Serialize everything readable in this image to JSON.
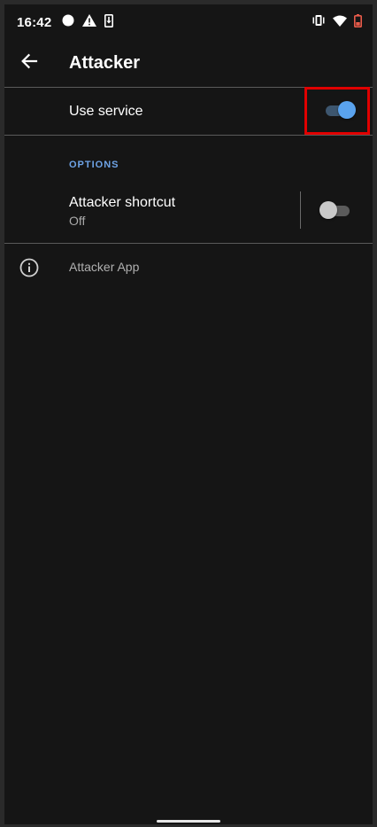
{
  "status_bar": {
    "time": "16:42",
    "icons_left": [
      "circle-notification-icon",
      "warning-icon",
      "download-icon"
    ],
    "icons_right": [
      "vibrate-icon",
      "wifi-icon",
      "battery-low-icon"
    ]
  },
  "app_bar": {
    "title": "Attacker",
    "back_icon": "arrow-left-icon"
  },
  "use_service": {
    "label": "Use service",
    "enabled": true,
    "highlighted": true,
    "highlight_color": "#e00000"
  },
  "options": {
    "header": "OPTIONS",
    "header_color": "#6ea3e6",
    "shortcut": {
      "title": "Attacker shortcut",
      "summary": "Off",
      "enabled": false
    }
  },
  "info": {
    "icon": "info-icon",
    "text": "Attacker App"
  },
  "colors": {
    "background": "#151515",
    "accent": "#5aa3ee",
    "divider": "#5a5a5a"
  }
}
